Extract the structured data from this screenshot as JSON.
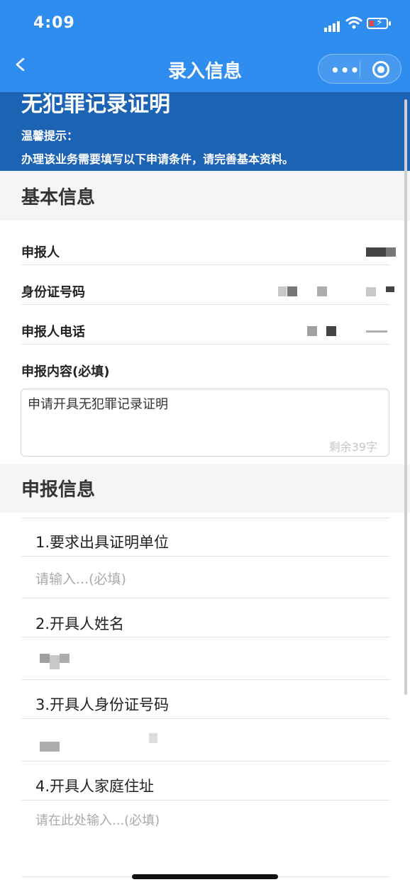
{
  "status": {
    "time": "4:09"
  },
  "nav": {
    "title": "录入信息",
    "more_glyph": "•••"
  },
  "banner": {
    "title": "无犯罪记录证明",
    "tip_label": "温馨提示：",
    "tip_text": "办理该业务需要填写以下申请条件，请完善基本资料。"
  },
  "basic": {
    "section_title": "基本信息",
    "applicant_label": "申报人",
    "id_label": "身份证号码",
    "phone_label": "申报人电话",
    "content_label": "申报内容(必填)",
    "content_value": "申请开具无犯罪记录证明",
    "counter": "剩余39字"
  },
  "report": {
    "section_title": "申报信息",
    "items": [
      {
        "label": "1.要求出具证明单位",
        "placeholder": "请输入...(必填)"
      },
      {
        "label": "2.开具人姓名"
      },
      {
        "label": "3.开具人身份证号码"
      },
      {
        "label": "4.开具人家庭住址",
        "placeholder": "请在此处输入...(必填)"
      }
    ]
  },
  "colors": {
    "nav": "#2f8df0",
    "banner": "#1d63b4",
    "section_bg": "#f5f5f7"
  }
}
